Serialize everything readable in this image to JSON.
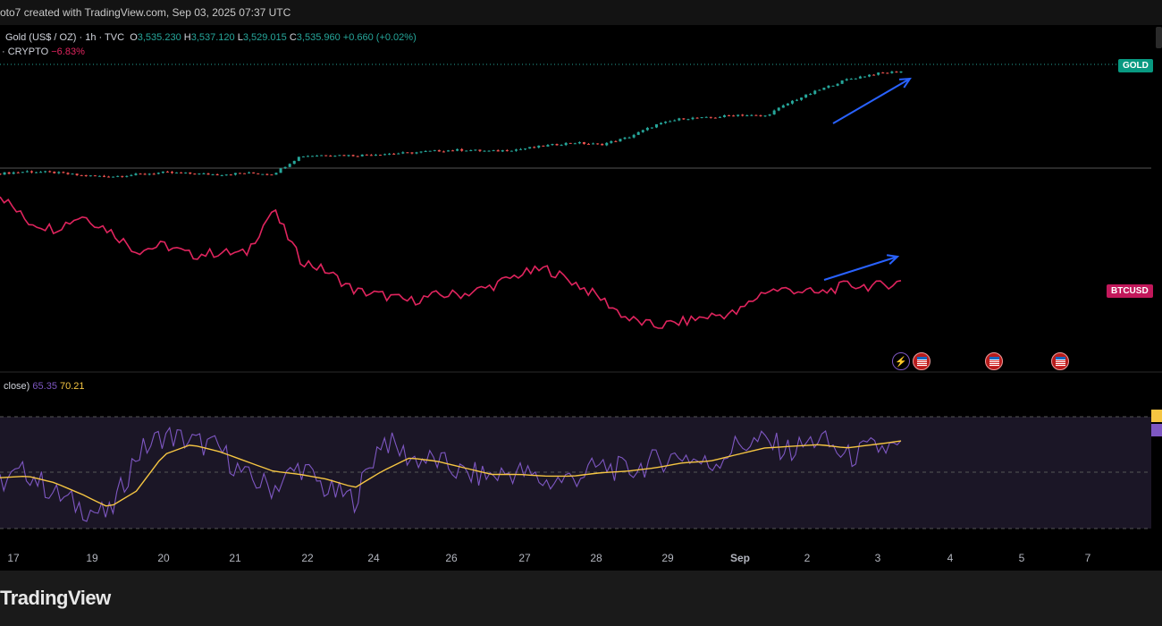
{
  "header": {
    "text": "oto7 created with TradingView.com, Sep 03, 2025 07:37 UTC"
  },
  "legend": {
    "symbol": "Gold (US$ / OZ) · 1h · TVC",
    "o_label": "O",
    "o": "3,535.230",
    "h_label": "H",
    "h": "3,537.120",
    "l_label": "L",
    "l": "3,529.015",
    "c_label": "C",
    "c": "3,535.960",
    "change": "+0.660 (+0.02%)",
    "compare_symbol": "· CRYPTO",
    "compare_change": "−6.83%",
    "rsi_label": "close)",
    "rsi_value": "65.35",
    "rsi_ma_value": "70.21"
  },
  "price_tags": {
    "gold": "GOLD",
    "btc": "BTCUSD"
  },
  "brand": "TradingView",
  "colors": {
    "up": "#26a69a",
    "down": "#ef5350",
    "btc": "#e0245e",
    "rsi": "#7e57c2",
    "rsi_ma": "#f5c542",
    "arrow": "#2962ff"
  },
  "events": [
    "lightning-icon",
    "us-flag-icon",
    "us-flag-icon",
    "us-flag-icon"
  ],
  "chart_data": [
    {
      "type": "line",
      "title": "Gold (US$ / OZ) · 1h · TVC",
      "x_ticks": [
        "17",
        "19",
        "20",
        "21",
        "22",
        "24",
        "26",
        "27",
        "28",
        "29",
        "Sep",
        "2",
        "3",
        "4",
        "5",
        "7"
      ],
      "series": [
        {
          "name": "GOLD",
          "values": [
            3338,
            3342,
            3340,
            3334,
            3332,
            3336,
            3340,
            3338,
            3336,
            3339,
            3337,
            3372,
            3374,
            3373,
            3376,
            3378,
            3382,
            3384,
            3381,
            3385,
            3392,
            3398,
            3394,
            3408,
            3432,
            3445,
            3446,
            3452,
            3449,
            3478,
            3500,
            3520,
            3531,
            3536
          ]
        },
        {
          "name": "BTCUSD",
          "values": [
            117300,
            115500,
            115000,
            115900,
            114900,
            113500,
            113900,
            113200,
            113400,
            113300,
            116300,
            112900,
            112100,
            110800,
            110500,
            110100,
            110500,
            110600,
            111100,
            111900,
            112300,
            111400,
            110300,
            108900,
            108400,
            108700,
            109100,
            109300,
            110800,
            110900,
            110600,
            111200,
            111100,
            111400
          ]
        }
      ]
    },
    {
      "type": "line",
      "title": "RSI (close)",
      "ylim": [
        0,
        100
      ],
      "series": [
        {
          "values": [
            45,
            52,
            38,
            30,
            25,
            62,
            74,
            70,
            66,
            48,
            42,
            55,
            40,
            35,
            72,
            60,
            58,
            50,
            49,
            52,
            45,
            48,
            55,
            52,
            58,
            62,
            55,
            68,
            70,
            64,
            72,
            60,
            66,
            65.35
          ]
        },
        {
          "values": [
            48,
            49,
            45,
            38,
            30,
            40,
            62,
            68,
            64,
            58,
            52,
            50,
            47,
            42,
            52,
            60,
            58,
            54,
            50,
            50,
            49,
            49,
            51,
            52,
            54,
            57,
            58,
            62,
            66,
            67,
            68,
            66,
            68,
            70.21
          ]
        }
      ]
    }
  ]
}
